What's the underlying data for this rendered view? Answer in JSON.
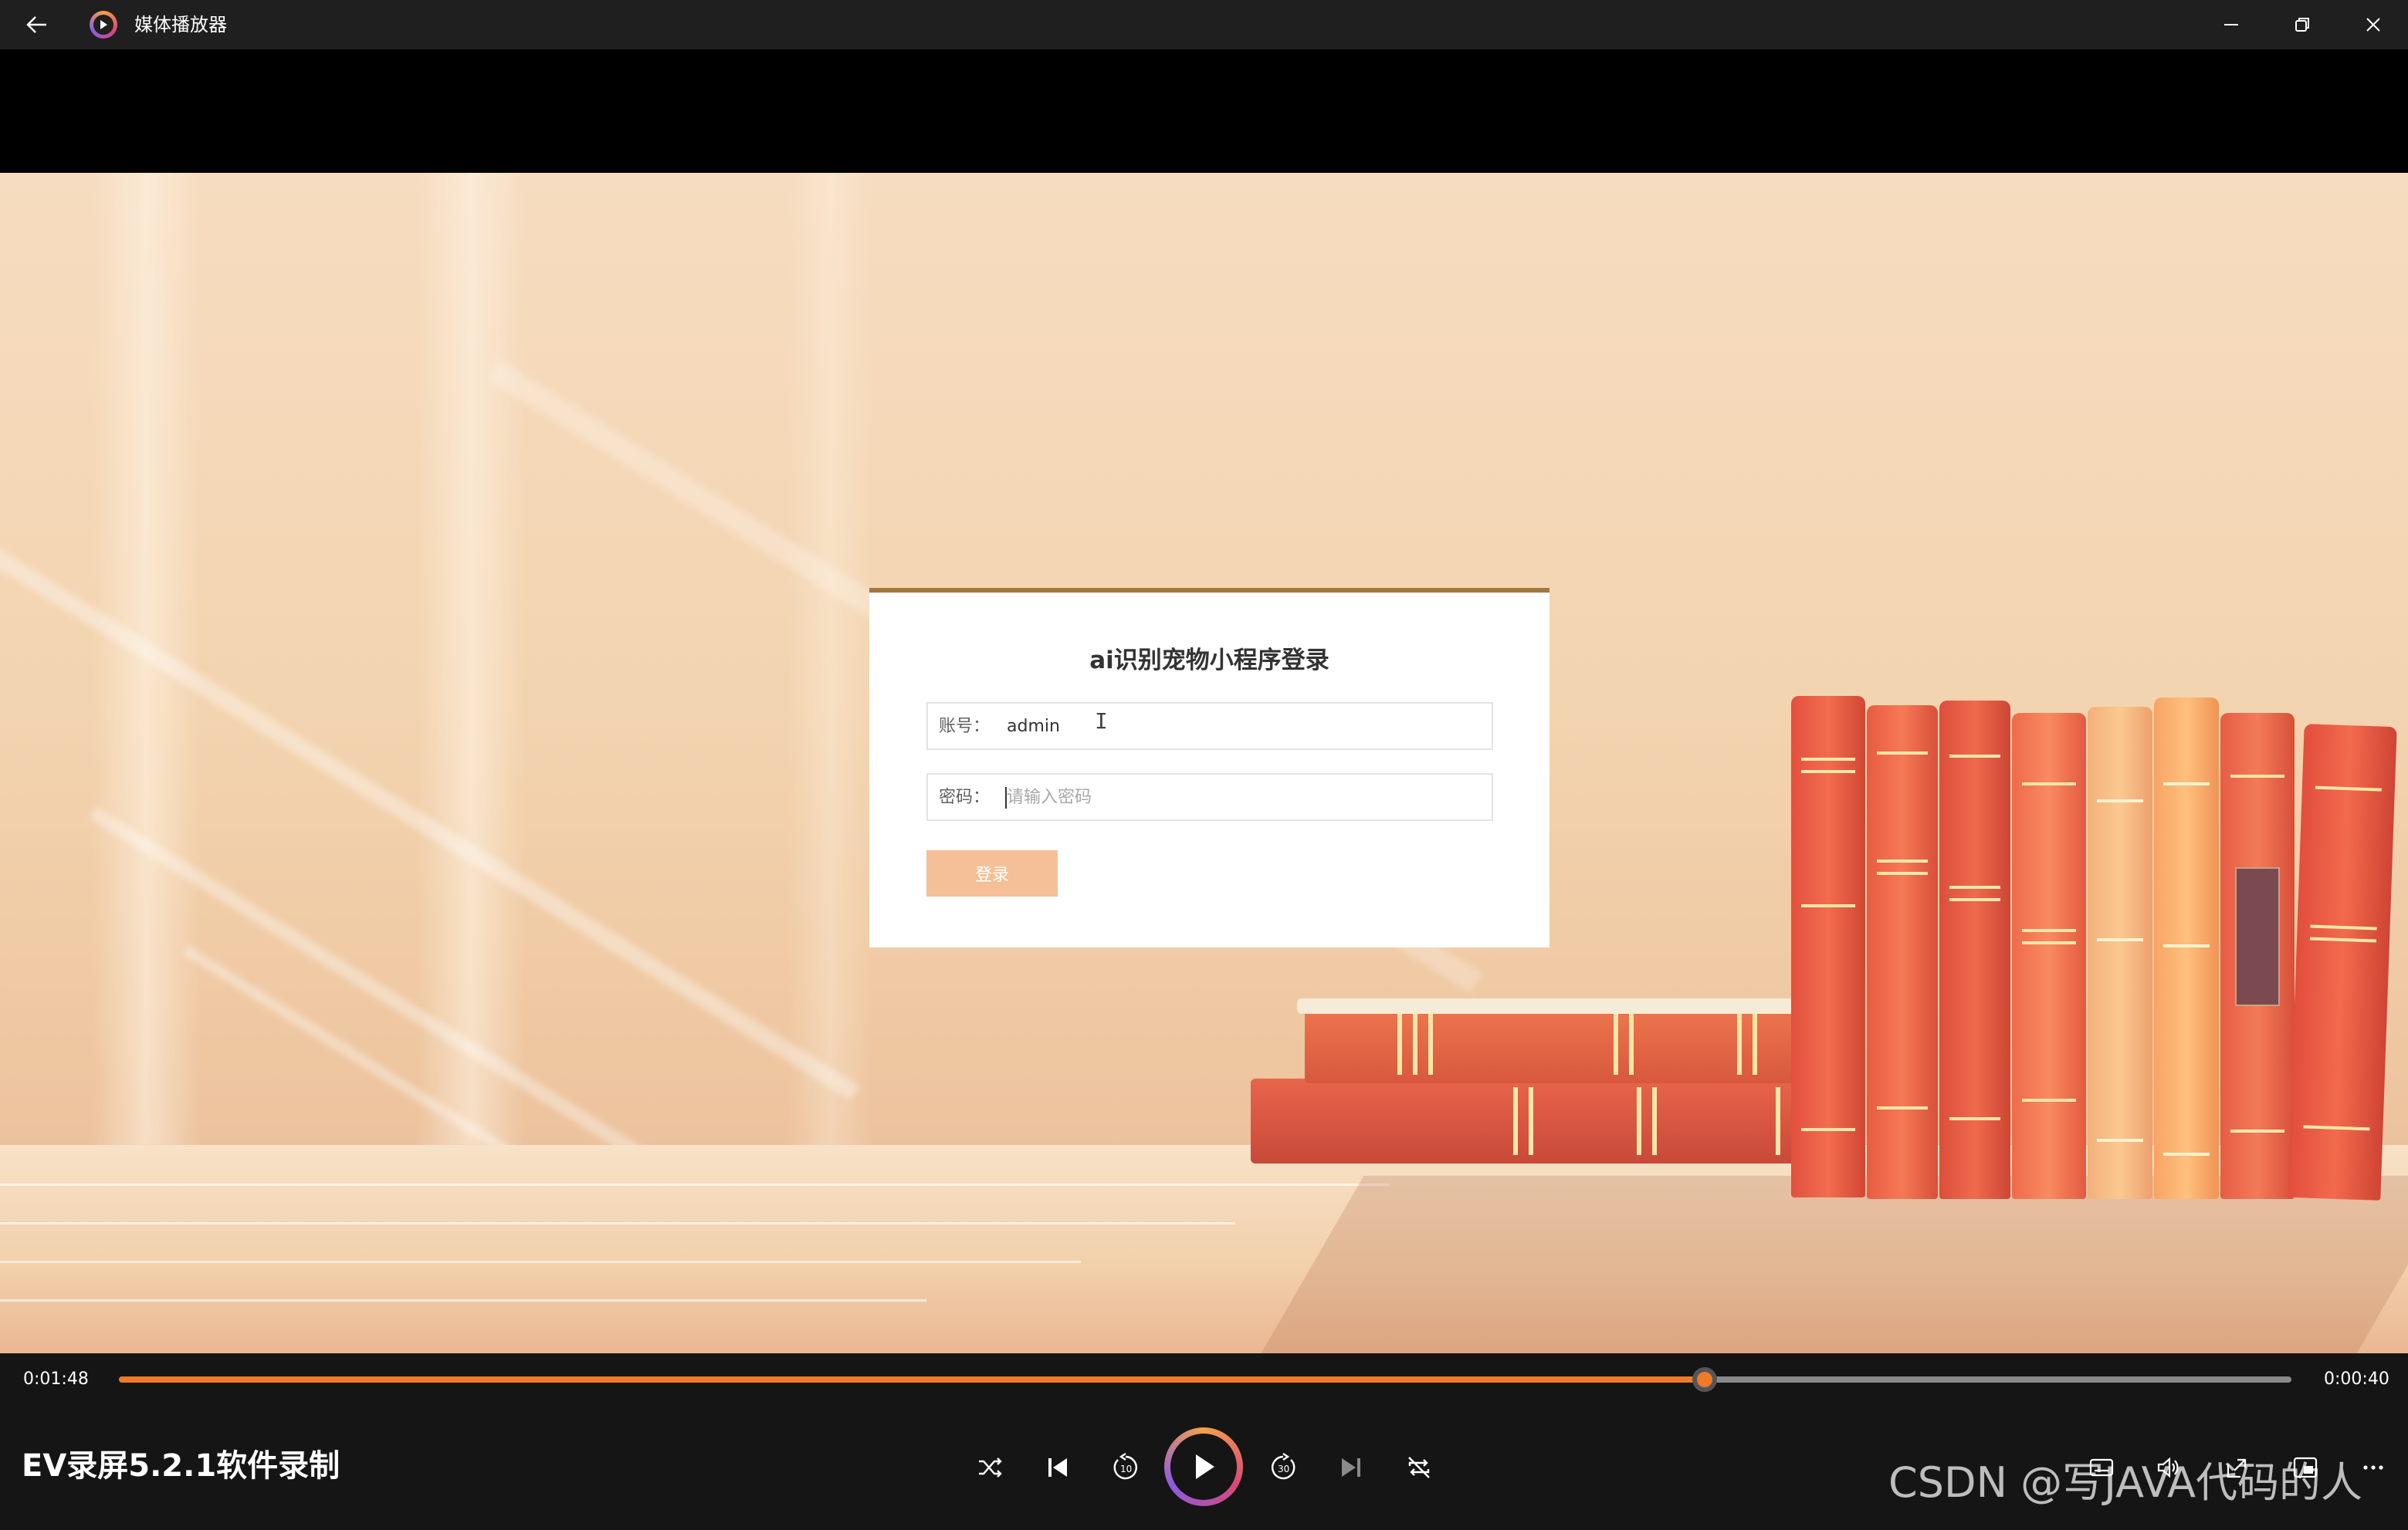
{
  "window": {
    "app_title": "媒体播放器"
  },
  "login": {
    "title": "ai识别宠物小程序登录",
    "account_label": "账号：",
    "account_value": "admin",
    "password_label": "密码：",
    "password_placeholder": "请输入密码",
    "submit_label": "登录"
  },
  "player": {
    "elapsed": "0:01:48",
    "remaining": "0:00:40",
    "progress_fraction": 0.73,
    "video_title": "EV录屏5.2.1软件录制",
    "accent_color": "#f07a2a"
  },
  "watermark": "CSDN @写JAVA代码的人",
  "icons": {
    "back": "back-arrow-icon",
    "app": "media-player-icon",
    "minimize": "minimize-icon",
    "restore": "restore-icon",
    "close": "close-icon",
    "shuffle": "shuffle-icon",
    "previous": "previous-icon",
    "rewind": "rewind-10-icon",
    "play": "play-icon",
    "forward": "forward-30-icon",
    "next": "next-icon",
    "repeat": "repeat-off-icon",
    "captions": "captions-icon",
    "volume": "volume-icon",
    "cast": "cast-icon",
    "miniplayer": "miniplayer-icon",
    "more": "more-icon"
  }
}
